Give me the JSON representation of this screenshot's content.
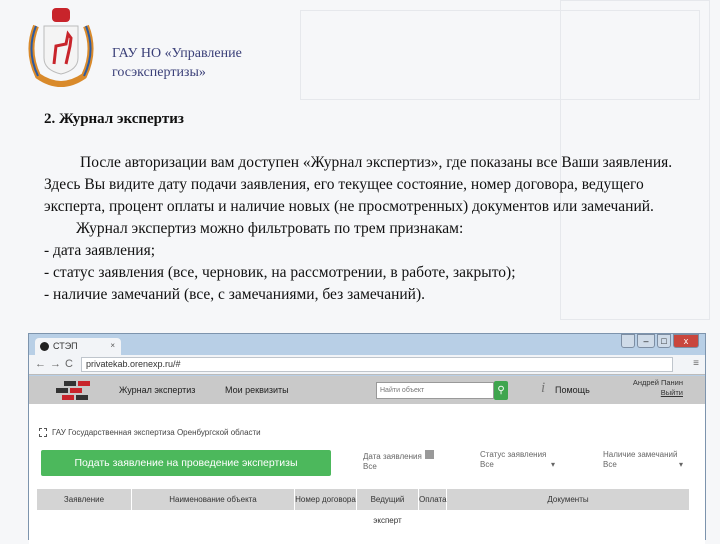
{
  "header": {
    "org_line1": "ГАУ НО «Управление",
    "org_line2": "госэкспертизы»"
  },
  "section": {
    "heading": "2. Журнал экспертиз",
    "para1": "После авторизации вам доступен «Журнал экспертиз», где показаны все Ваши заявления. Здесь Вы видите дату подачи заявления, его текущее состояние, номер договора, ведущего эксперта, процент оплаты и наличие новых (не просмотренных) документов или замечаний.",
    "para2": "Журнал экспертиз можно фильтровать по трем признакам:",
    "items": [
      "- дата заявления;",
      "- статус заявления (все, черновик, на рассмотрении, в работе, закрыто);",
      "- наличие замечаний (все, с замечаниями, без замечаний)."
    ]
  },
  "browser": {
    "tab_title": "СТЭП",
    "url": "privatekab.orenexp.ru/#"
  },
  "app": {
    "nav": [
      "Журнал экспертиз",
      "Мои реквизиты"
    ],
    "search_placeholder": "Найти объект",
    "help": "Помощь",
    "user_name": "Андрей Панин",
    "logout": "Выйти",
    "company": "ГАУ Государственная экспертиза Оренбургской области",
    "submit_button": "Подать заявление на проведение экспертизы",
    "filters": [
      {
        "label": "Дата заявления",
        "value": "Все"
      },
      {
        "label": "Статус заявления",
        "value": "Все"
      },
      {
        "label": "Наличие замечаний",
        "value": "Все"
      }
    ],
    "columns": [
      "Заявление",
      "Наименование объекта",
      "Номер договора",
      "Ведущий эксперт",
      "Оплата",
      "Документы"
    ]
  },
  "colors": {
    "accent_green": "#4cb85c",
    "org_text": "#3a3f78"
  }
}
